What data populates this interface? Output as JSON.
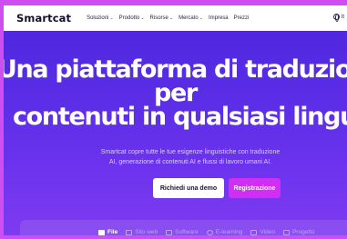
{
  "nav": {
    "logo": "Smartcat",
    "items": [
      {
        "label": "Soluzioni",
        "dropdown": true
      },
      {
        "label": "Prodotto",
        "dropdown": true
      },
      {
        "label": "Risorse",
        "dropdown": true
      },
      {
        "label": "Mercato",
        "dropdown": true
      },
      {
        "label": "Impresa",
        "dropdown": false
      },
      {
        "label": "Prezzi",
        "dropdown": false
      }
    ],
    "language": "It"
  },
  "hero": {
    "title_line1": "Una piattaforma di traduzion",
    "title_line2": "per",
    "title_line3": "contenuti in qualsiasi lingu",
    "subtitle_line1": "Smartcat copre tutte le tue esigenze linguistiche con traduzione",
    "subtitle_line2": "AI, generazione di contenuti AI e flussi di lavoro umani AI.",
    "demo_button": "Richiedi una demo",
    "register_button": "Registrazione"
  },
  "tabs": [
    {
      "label": "File",
      "icon": "file-icon",
      "active": true
    },
    {
      "label": "Sito web",
      "icon": "web-icon",
      "active": false
    },
    {
      "label": "Software",
      "icon": "code-icon",
      "active": false
    },
    {
      "label": "E-learning",
      "icon": "graduation-cap-icon",
      "active": false
    },
    {
      "label": "Video",
      "icon": "play-icon",
      "active": false
    },
    {
      "label": "Progetto",
      "icon": "document-icon",
      "active": false
    }
  ],
  "colors": {
    "page_border": "#cf4ef0",
    "hero_gradient_top": "#4b26dc",
    "hero_gradient_bottom": "#7f3bf0",
    "register_button": "#d02ff3"
  }
}
